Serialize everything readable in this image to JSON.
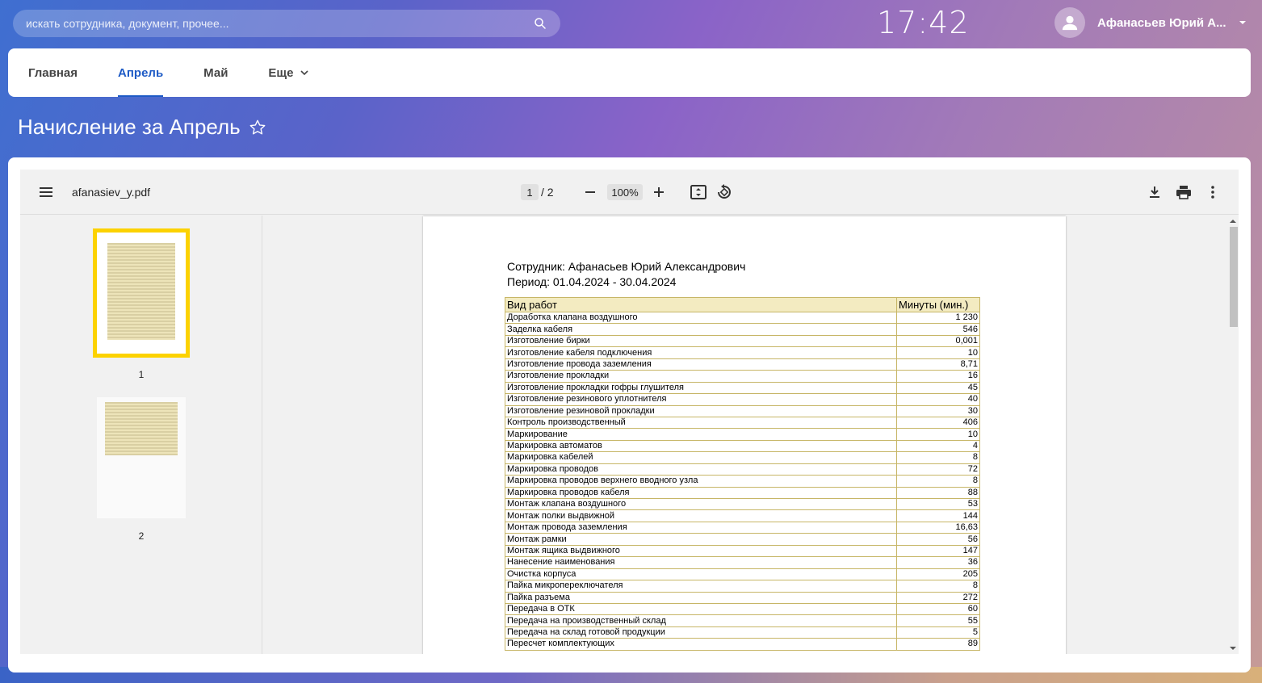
{
  "search": {
    "placeholder": "искать сотрудника, документ, прочее..."
  },
  "clock": "17:42",
  "user": {
    "name": "Афанасьев Юрий А..."
  },
  "nav": {
    "tabs": [
      {
        "label": "Главная"
      },
      {
        "label": "Апрель"
      },
      {
        "label": "Май"
      },
      {
        "label": "Еще"
      }
    ]
  },
  "page_title": "Начисление за Апрель",
  "viewer": {
    "filename": "afanasiev_y.pdf",
    "current_page": "1",
    "page_separator": "/ 2",
    "zoom": "100%",
    "thumbnails": [
      {
        "label": "1"
      },
      {
        "label": "2"
      }
    ]
  },
  "document": {
    "employee": "Сотрудник: Афанасьев Юрий Александрович",
    "period": "Период: 01.04.2024 - 30.04.2024",
    "columns": {
      "work": "Вид работ",
      "minutes": "Минуты (мин.)"
    },
    "rows": [
      {
        "name": "Доработка клапана воздушного",
        "value": "1 230"
      },
      {
        "name": "Заделка кабеля",
        "value": "546"
      },
      {
        "name": "Изготовление бирки",
        "value": "0,001"
      },
      {
        "name": "Изготовление кабеля подключения",
        "value": "10"
      },
      {
        "name": "Изготовление провода заземления",
        "value": "8,71"
      },
      {
        "name": "Изготовление прокладки",
        "value": "16"
      },
      {
        "name": "Изготовление прокладки гофры глушителя",
        "value": "45"
      },
      {
        "name": "Изготовление резинового уплотнителя",
        "value": "40"
      },
      {
        "name": "Изготовление резиновой прокладки",
        "value": "30"
      },
      {
        "name": "Контроль производственный",
        "value": "406"
      },
      {
        "name": "Маркирование",
        "value": "10"
      },
      {
        "name": "Маркировка автоматов",
        "value": "4"
      },
      {
        "name": "Маркировка кабелей",
        "value": "8"
      },
      {
        "name": "Маркировка проводов",
        "value": "72"
      },
      {
        "name": "Маркировка проводов верхнего вводного узла",
        "value": "8"
      },
      {
        "name": "Маркировка проводов кабеля",
        "value": "88"
      },
      {
        "name": "Монтаж клапана воздушного",
        "value": "53"
      },
      {
        "name": "Монтаж полки выдвижной",
        "value": "144"
      },
      {
        "name": "Монтаж провода заземления",
        "value": "16,63"
      },
      {
        "name": "Монтаж рамки",
        "value": "56"
      },
      {
        "name": "Монтаж ящика выдвижного",
        "value": "147"
      },
      {
        "name": "Нанесение наименования",
        "value": "36"
      },
      {
        "name": "Очистка корпуса",
        "value": "205"
      },
      {
        "name": "Пайка микропереключателя",
        "value": "8"
      },
      {
        "name": "Пайка разъема",
        "value": "272"
      },
      {
        "name": "Передача в ОТК",
        "value": "60"
      },
      {
        "name": "Передача на производственный склад",
        "value": "55"
      },
      {
        "name": "Передача на склад готовой продукции",
        "value": "5"
      },
      {
        "name": "Пересчет комплектующих",
        "value": "89"
      }
    ]
  },
  "colors": {
    "accent": "#1e5bc6",
    "thumb_highlight": "#fcd200",
    "table_header": "#f3ebc1"
  }
}
